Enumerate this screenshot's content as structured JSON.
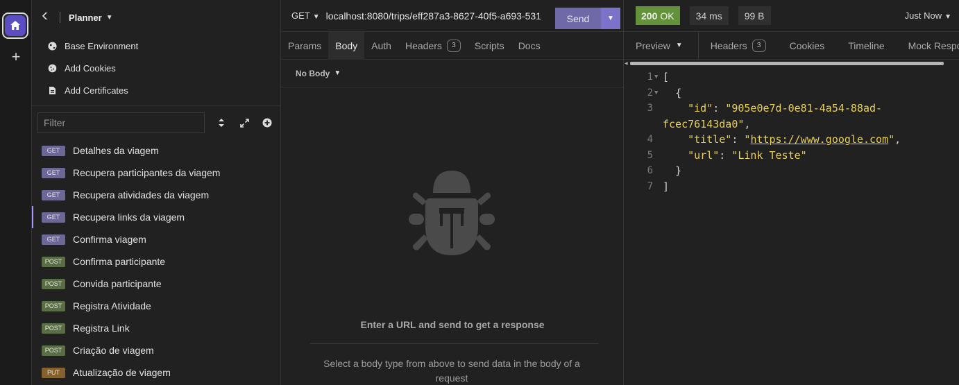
{
  "rail": {
    "home_icon": "home-icon",
    "add_label": "+"
  },
  "sidebar": {
    "project_name": "Planner",
    "env_items": [
      {
        "label": "Base Environment",
        "icon": "globe-icon"
      },
      {
        "label": "Add Cookies",
        "icon": "cookie-icon"
      },
      {
        "label": "Add Certificates",
        "icon": "certificate-icon"
      }
    ],
    "filter_placeholder": "Filter",
    "requests": [
      {
        "method": "GET",
        "name": "Detalhes da viagem"
      },
      {
        "method": "GET",
        "name": "Recupera participantes da viagem"
      },
      {
        "method": "GET",
        "name": "Recupera atividades da viagem"
      },
      {
        "method": "GET",
        "name": "Recupera links da viagem",
        "active": true
      },
      {
        "method": "GET",
        "name": "Confirma viagem"
      },
      {
        "method": "POST",
        "name": "Confirma participante"
      },
      {
        "method": "POST",
        "name": "Convida participante"
      },
      {
        "method": "POST",
        "name": "Registra Atividade"
      },
      {
        "method": "POST",
        "name": "Registra Link"
      },
      {
        "method": "POST",
        "name": "Criação de viagem"
      },
      {
        "method": "PUT",
        "name": "Atualização de viagem"
      }
    ]
  },
  "request": {
    "method": "GET",
    "url": "localhost:8080/trips/eff287a3-8627-40f5-a693-531",
    "send_label": "Send",
    "tabs": [
      {
        "label": "Params"
      },
      {
        "label": "Body",
        "active": true
      },
      {
        "label": "Auth"
      },
      {
        "label": "Headers",
        "count": "3"
      },
      {
        "label": "Scripts"
      },
      {
        "label": "Docs"
      }
    ],
    "body_type": "No Body",
    "empty_title": "Enter a URL and send to get a response",
    "empty_sub": "Select a body type from above to send data in the body of a request"
  },
  "response": {
    "status_code": "200",
    "status_text": "OK",
    "time": "34 ms",
    "size": "99 B",
    "history": "Just Now",
    "tabs": [
      {
        "label": "Preview"
      },
      {
        "label": "Headers",
        "count": "3"
      },
      {
        "label": "Cookies"
      },
      {
        "label": "Timeline"
      },
      {
        "label": "Mock Respons"
      }
    ],
    "code_lines": [
      {
        "n": "1",
        "fold": true
      },
      {
        "n": "2",
        "fold": true
      },
      {
        "n": "3"
      },
      {
        "n": ""
      },
      {
        "n": "4"
      },
      {
        "n": "5"
      },
      {
        "n": "6"
      },
      {
        "n": "7"
      }
    ],
    "json": {
      "open_bracket": "[",
      "open_brace": "{",
      "id_key": "\"id\"",
      "id_value_1": "\"905e0e7d-0e81-4a54-88ad-",
      "id_value_2": "fcec76143da0\"",
      "title_key": "\"title\"",
      "title_value": "https://www.google.com",
      "url_key": "\"url\"",
      "url_value": "\"Link Teste\"",
      "close_brace": "}",
      "close_bracket": "]"
    }
  },
  "colors": {
    "accent": "#7c72c9",
    "status_ok": "#63923a",
    "get_badge": "#6c6895",
    "post_badge": "#5a6e43",
    "put_badge": "#85622d",
    "json_string": "#e8d05b"
  }
}
